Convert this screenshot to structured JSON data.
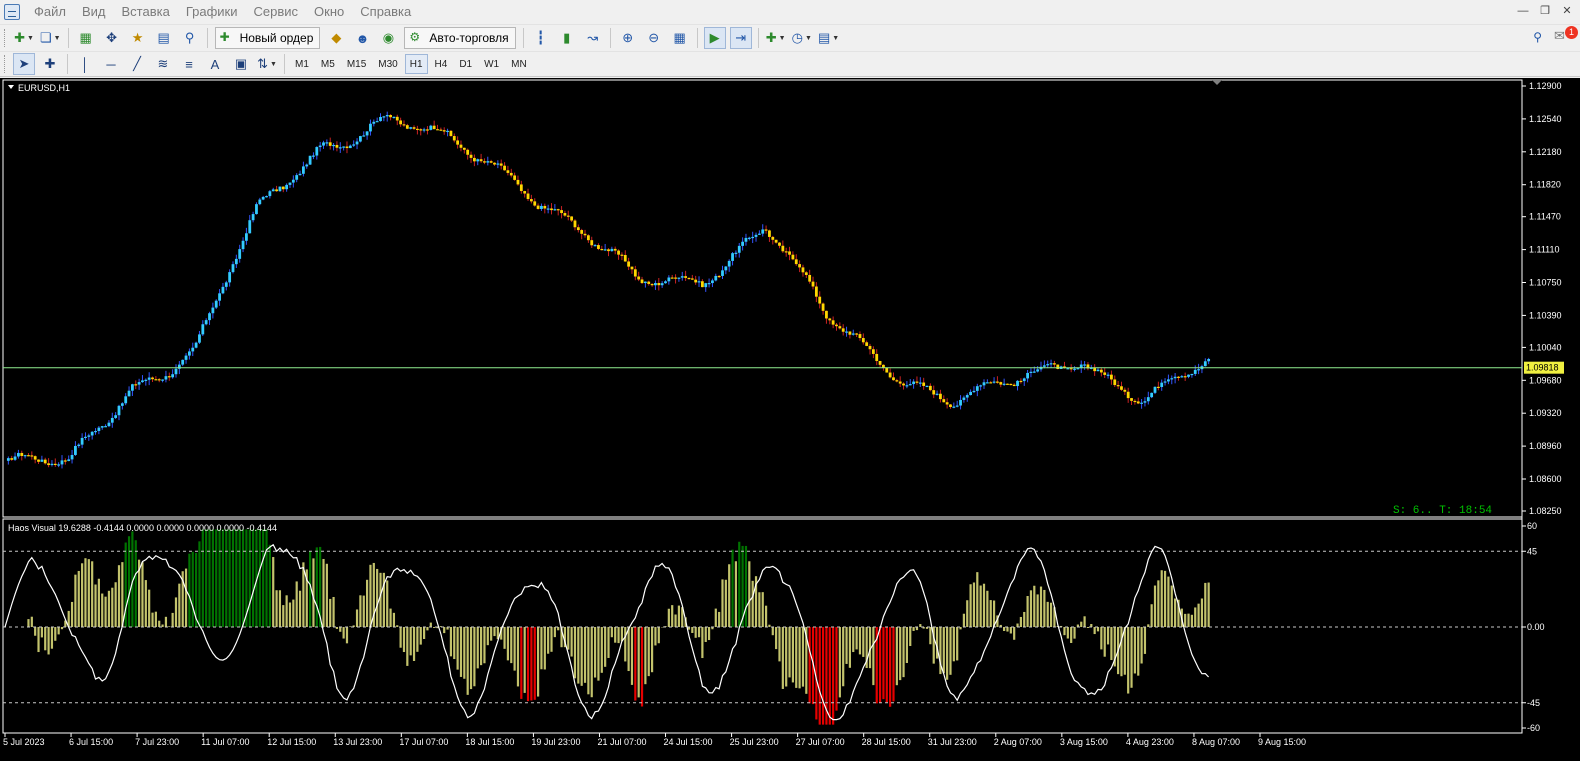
{
  "menu": {
    "items": [
      "Файл",
      "Вид",
      "Вставка",
      "Графики",
      "Сервис",
      "Окно",
      "Справка"
    ]
  },
  "toolbar": {
    "new_order_label": "Новый ордер",
    "auto_trading_label": "Авто-торговля",
    "notification_count": "1"
  },
  "timeframes": {
    "items": [
      "M1",
      "M5",
      "M15",
      "M30",
      "H1",
      "H4",
      "D1",
      "W1",
      "MN"
    ],
    "active": "H1"
  },
  "chart": {
    "symbol_title": "EURUSD,H1",
    "current_price": "1.09818",
    "status_text": "S: 6.. T: 18:54",
    "price_ticks": [
      "1.12900",
      "1.12540",
      "1.12180",
      "1.11820",
      "1.11470",
      "1.11110",
      "1.10750",
      "1.10390",
      "1.10040",
      "1.09680",
      "1.09320",
      "1.08960",
      "1.08600",
      "1.08250"
    ],
    "time_ticks": [
      "5 Jul 2023",
      "6 Jul 15:00",
      "7 Jul 23:00",
      "11 Jul 07:00",
      "12 Jul 15:00",
      "13 Jul 23:00",
      "17 Jul 07:00",
      "18 Jul 15:00",
      "19 Jul 23:00",
      "21 Jul 07:00",
      "24 Jul 15:00",
      "25 Jul 23:00",
      "27 Jul 07:00",
      "28 Jul 15:00",
      "31 Jul 23:00",
      "2 Aug 07:00",
      "3 Aug 15:00",
      "4 Aug 23:00",
      "8 Aug 07:00",
      "9 Aug 15:00"
    ],
    "colors": {
      "background": "#000000",
      "bull": "#33ccff",
      "bear": "#ffd700",
      "price_line": "#90ee90",
      "price_label_bg": "#f0f040",
      "status_text": "#00c000"
    }
  },
  "indicator": {
    "title": "Haos Visual 19.6288 -0.4144 0.0000 0.0000 0.0000 0.0000 -0.4144",
    "scale_ticks": [
      "60",
      "45",
      "0.00",
      "-45",
      "-60"
    ],
    "colors": {
      "histogram": "#d8d878",
      "strong_up": "#008000",
      "strong_down": "#ff0000",
      "signal_line": "#ffffff",
      "level_lines": "#c8c8c8"
    }
  },
  "chart_data": {
    "type": "line",
    "series": [
      {
        "name": "EURUSD,H1",
        "x": [
          "5 Jul 2023",
          "6 Jul 15:00",
          "7 Jul 23:00",
          "11 Jul 07:00",
          "12 Jul 15:00",
          "13 Jul 23:00",
          "17 Jul 07:00",
          "18 Jul 15:00",
          "19 Jul 23:00",
          "21 Jul 07:00",
          "24 Jul 15:00",
          "25 Jul 23:00",
          "27 Jul 07:00",
          "28 Jul 15:00",
          "31 Jul 23:00",
          "2 Aug 07:00",
          "3 Aug 15:00",
          "4 Aug 23:00",
          "8 Aug 07:00",
          "9 Aug 15:00"
        ],
        "values": [
          1.0878,
          1.0872,
          1.0965,
          1.1001,
          1.115,
          1.1228,
          1.1255,
          1.1225,
          1.1195,
          1.1138,
          1.107,
          1.1082,
          1.114,
          1.103,
          1.0982,
          1.0948,
          1.0962,
          1.0994,
          1.095,
          1.0982
        ]
      }
    ],
    "ylim": [
      1.0825,
      1.129
    ],
    "indicator_ylim": [
      -60,
      60
    ],
    "indicator_levels": [
      45,
      0,
      -45
    ]
  }
}
